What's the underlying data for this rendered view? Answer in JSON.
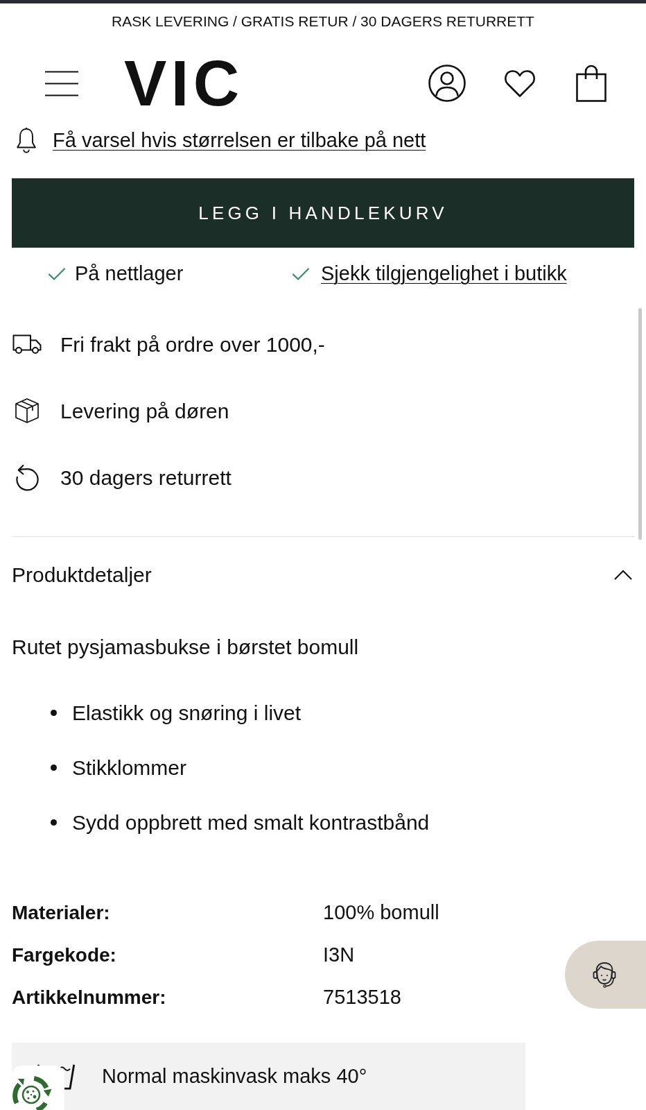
{
  "announcement": {
    "text": "RASK LEVERING / GRATIS RETUR / 30 DAGERS RETURRETT"
  },
  "header": {
    "logo": "VIC"
  },
  "stock_alert": {
    "link": "Få varsel hvis størrelsen er tilbake på nett"
  },
  "add_to_cart": {
    "label": "LEGG I HANDLEKURV"
  },
  "availability": [
    {
      "kind": "status",
      "label": "På nettlager"
    },
    {
      "kind": "link",
      "label": "Sjekk tilgjengelighet i butikk"
    }
  ],
  "benefits": [
    {
      "kind": "truck",
      "label": "Fri frakt på ordre over 1000,-"
    },
    {
      "kind": "package",
      "label": "Levering på døren"
    },
    {
      "kind": "return",
      "label": "30 dagers returrett"
    }
  ],
  "product_details": {
    "title": "Produktdetaljer",
    "expanded": true,
    "description": "Rutet pysjamasbukse i børstet bomull",
    "bullets": [
      "Elastikk og snøring i livet",
      "Stikklommer",
      "Sydd oppbrett med smalt kontrastbånd"
    ],
    "attributes": [
      {
        "label": "Materialer:",
        "value": "100% bomull"
      },
      {
        "label": "Fargekode:",
        "value": "I3N"
      },
      {
        "label": "Artikkelnummer:",
        "value": "7513518"
      }
    ],
    "care": [
      {
        "kind": "wash",
        "label": "Normal maskinvask maks 40°"
      }
    ]
  }
}
